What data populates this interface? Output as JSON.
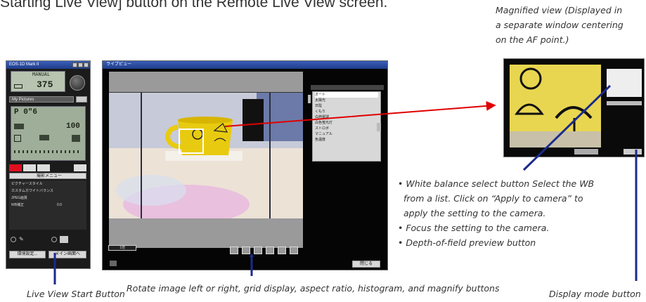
{
  "heading": "Starting Live View] button on the Remote Live View screen.",
  "magnified_caption": [
    "Magnified view (Displayed in",
    "a separate window centering",
    "on the AF point.)"
  ],
  "bullets": [
    "• White balance select button Select the WB",
    "from a list. Click on “Apply to camera” to",
    "apply the setting to the camera.",
    "• Focus the setting to the camera.",
    "• Depth-of-field preview button"
  ],
  "captions": {
    "live_view_start": "Live View Start Button",
    "toolbar_buttons": "Rotate image left or right, grid display, aspect ratio, histogram, and magnify buttons",
    "display_mode": "Display mode button"
  },
  "camera_panel": {
    "title": "EOS-1D Mark II",
    "mode": "MANUAL",
    "shots": "375",
    "folder": "My Pictures",
    "exposure": "P  0\"6",
    "iso": "100",
    "tab_label": "撮影メニュー",
    "rows": [
      {
        "label": "ピクチャースタイル",
        "value": ""
      },
      {
        "label": "カスタムホワイトバランス",
        "value": ""
      },
      {
        "label": "JPEG画質",
        "value": ""
      },
      {
        "label": "WB補正",
        "value": "0.0"
      }
    ],
    "btn_left": "環境設定...",
    "btn_right": "メイン画面へ"
  },
  "live_view_window": {
    "title": "ライブビュー",
    "zoom_label": "1倍",
    "close_label": "閉じる",
    "wb_items": [
      "オート",
      "太陽光",
      "日陰",
      "くもり",
      "白熱電球",
      "白色蛍光灯",
      "ストロボ",
      "マニュアル",
      "色温度"
    ]
  },
  "colors": {
    "callout_blue": "#1a2a8c",
    "arrow_red": "#e00000",
    "af_box": "#ffffff"
  }
}
